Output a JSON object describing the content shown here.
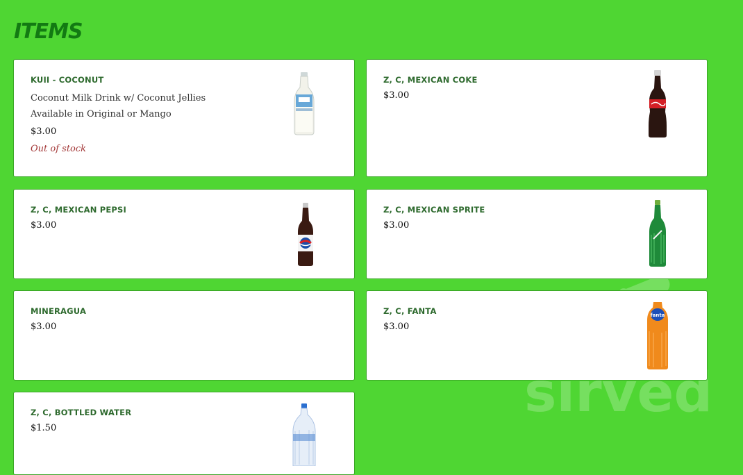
{
  "section": {
    "title": "ITEMS"
  },
  "watermark": {
    "text": "sirved"
  },
  "items": [
    {
      "name": "KUII - COCONUT",
      "description": "Coconut Milk Drink w/ Coconut Jellies Available in Original or Mango",
      "price": "$3.00",
      "stock": "Out of stock",
      "image": "coconut-milk-bottle"
    },
    {
      "name": "Z, C, MEXICAN COKE",
      "price": "$3.00",
      "image": "coke-bottle"
    },
    {
      "name": "Z, C, MEXICAN PEPSI",
      "price": "$3.00",
      "image": "pepsi-bottle"
    },
    {
      "name": "Z, C, MEXICAN SPRITE",
      "price": "$3.00",
      "image": "sprite-bottle"
    },
    {
      "name": "MINERAGUA",
      "price": "$3.00"
    },
    {
      "name": "Z, C, FANTA",
      "price": "$3.00",
      "image": "fanta-bottle"
    },
    {
      "name": "Z, C, BOTTLED WATER",
      "price": "$1.50",
      "image": "water-bottle"
    }
  ]
}
